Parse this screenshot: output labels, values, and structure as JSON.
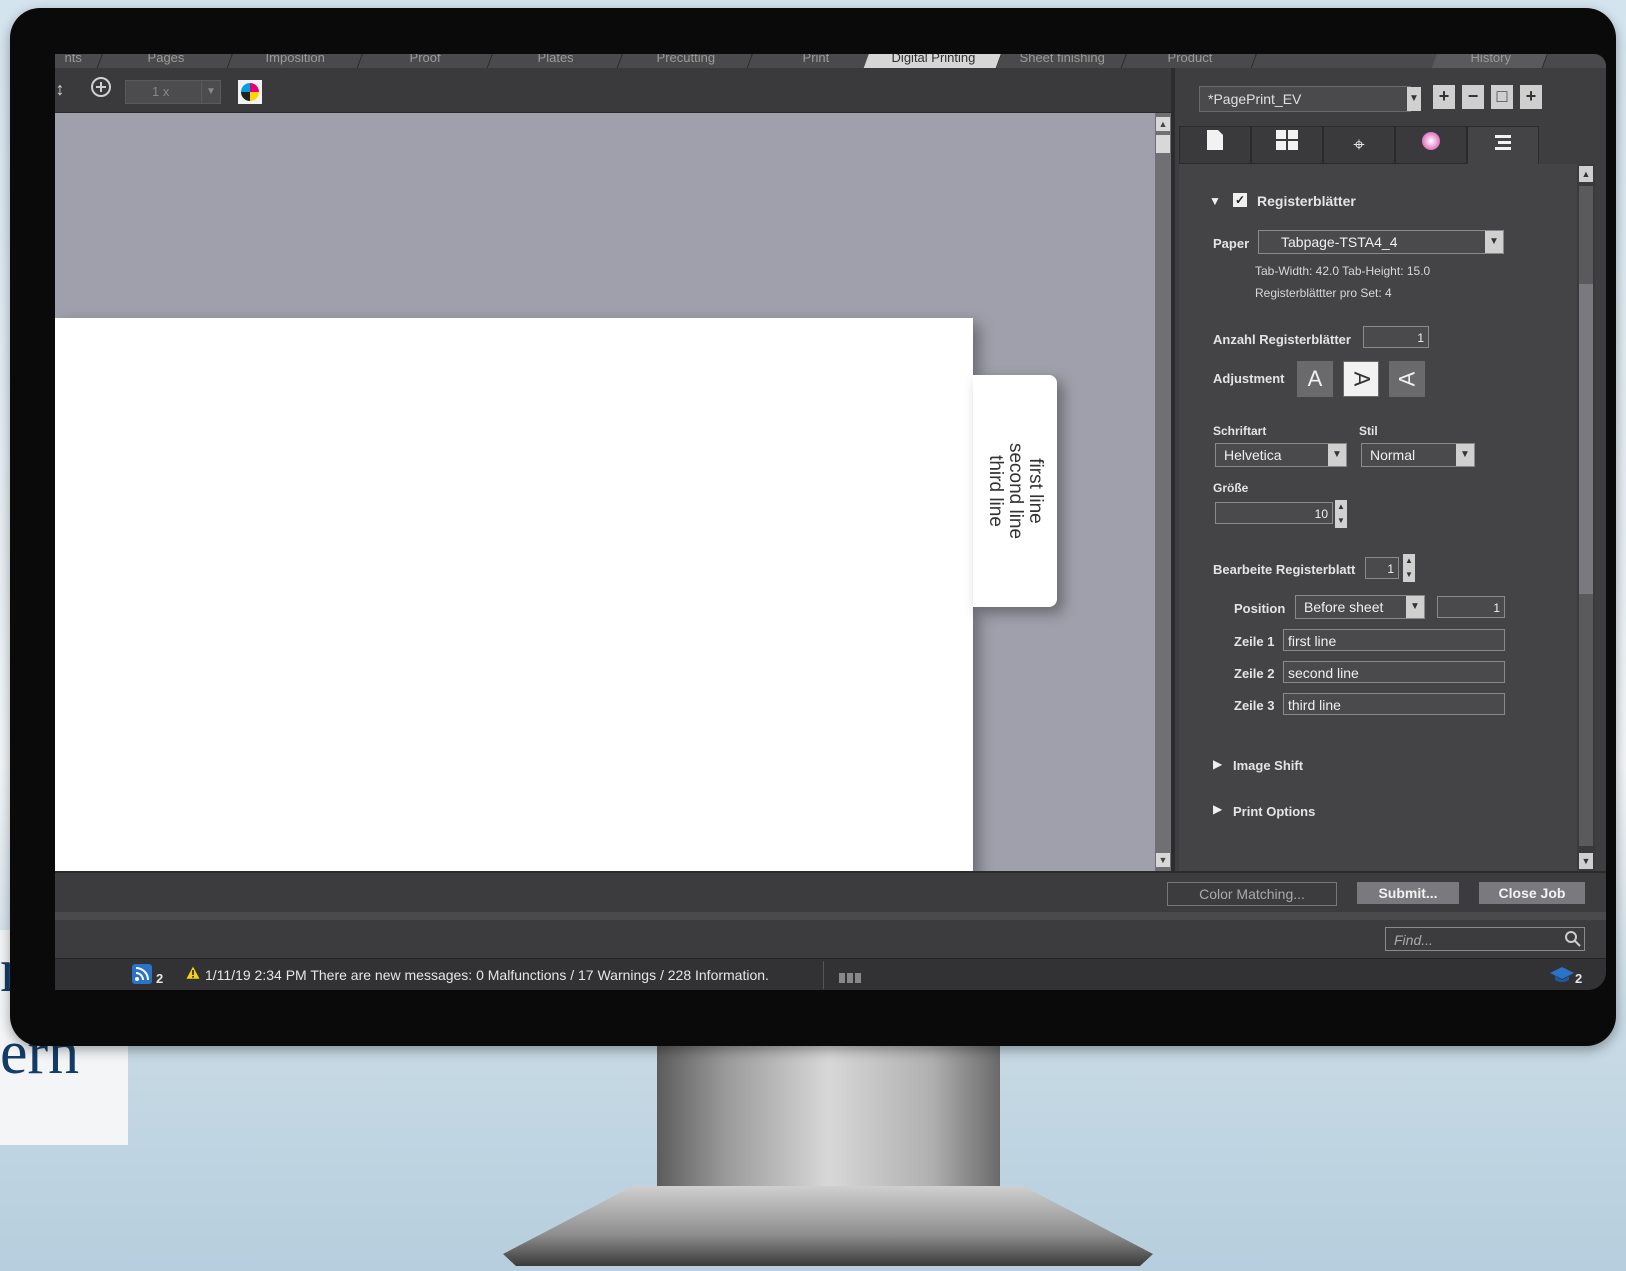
{
  "background": {
    "left_text_lines": [
      "n",
      "ern"
    ]
  },
  "app": {
    "tabs": [
      {
        "label": "nts"
      },
      {
        "label": "Pages"
      },
      {
        "label": "Imposition"
      },
      {
        "label": "Proof"
      },
      {
        "label": "Plates"
      },
      {
        "label": "Precutting"
      },
      {
        "label": "Print"
      },
      {
        "label": "Digital Printing"
      },
      {
        "label": "Sheet finishing"
      },
      {
        "label": "Product"
      },
      {
        "label": "History"
      }
    ],
    "active_tab": "Digital Printing"
  },
  "toolbar": {
    "zoom_value": "1 x",
    "icons": [
      "fit-height-icon",
      "zoom-in-icon",
      "chevron-down-icon",
      "cmyk-icon"
    ]
  },
  "canvas": {
    "tab_lines": [
      "first line",
      "second line",
      "third line"
    ]
  },
  "right_panel": {
    "preset": "*PagePrint_EV",
    "preset_buttons": [
      "+",
      "−",
      "□",
      "+"
    ],
    "panel_tabs": [
      "document-icon",
      "layout-icon",
      "crosshair-icon",
      "color-wheel-icon",
      "list-icon"
    ],
    "section_title": "Registerblätter",
    "section_checked": true,
    "paper_label": "Paper",
    "paper_value": "Tabpage-TSTA4_4",
    "tab_info_1": "Tab-Width: 42.0   Tab-Height: 15.0",
    "tab_info_2": "Registerblättter pro Set: 4",
    "count_label": "Anzahl Registerblätter",
    "count_value": "1",
    "adjustment_label": "Adjustment",
    "adjustment_buttons": [
      "A",
      "A",
      "A"
    ],
    "font_label": "Schriftart",
    "font_value": "Helvetica",
    "style_label": "Stil",
    "style_value": "Normal",
    "size_label": "Größe",
    "size_value": "10",
    "edit_label": "Bearbeite Registerblatt",
    "edit_value": "1",
    "position_label": "Position",
    "position_value": "Before sheet",
    "position_num": "1",
    "line1_label": "Zeile 1",
    "line1_value": "first line",
    "line2_label": "Zeile 2",
    "line2_value": "second line",
    "line3_label": "Zeile 3",
    "line3_value": "third line",
    "image_shift_label": "Image Shift",
    "print_options_label": "Print Options"
  },
  "buttons": {
    "color_matching": "Color Matching...",
    "submit": "Submit...",
    "close_job": "Close Job"
  },
  "find": {
    "placeholder": "Find..."
  },
  "status": {
    "rss_count": "2",
    "message": "1/11/19 2:34 PM  There are new messages: 0 Malfunctions / 17 Warnings / 228 Information.",
    "right_count": "2"
  }
}
